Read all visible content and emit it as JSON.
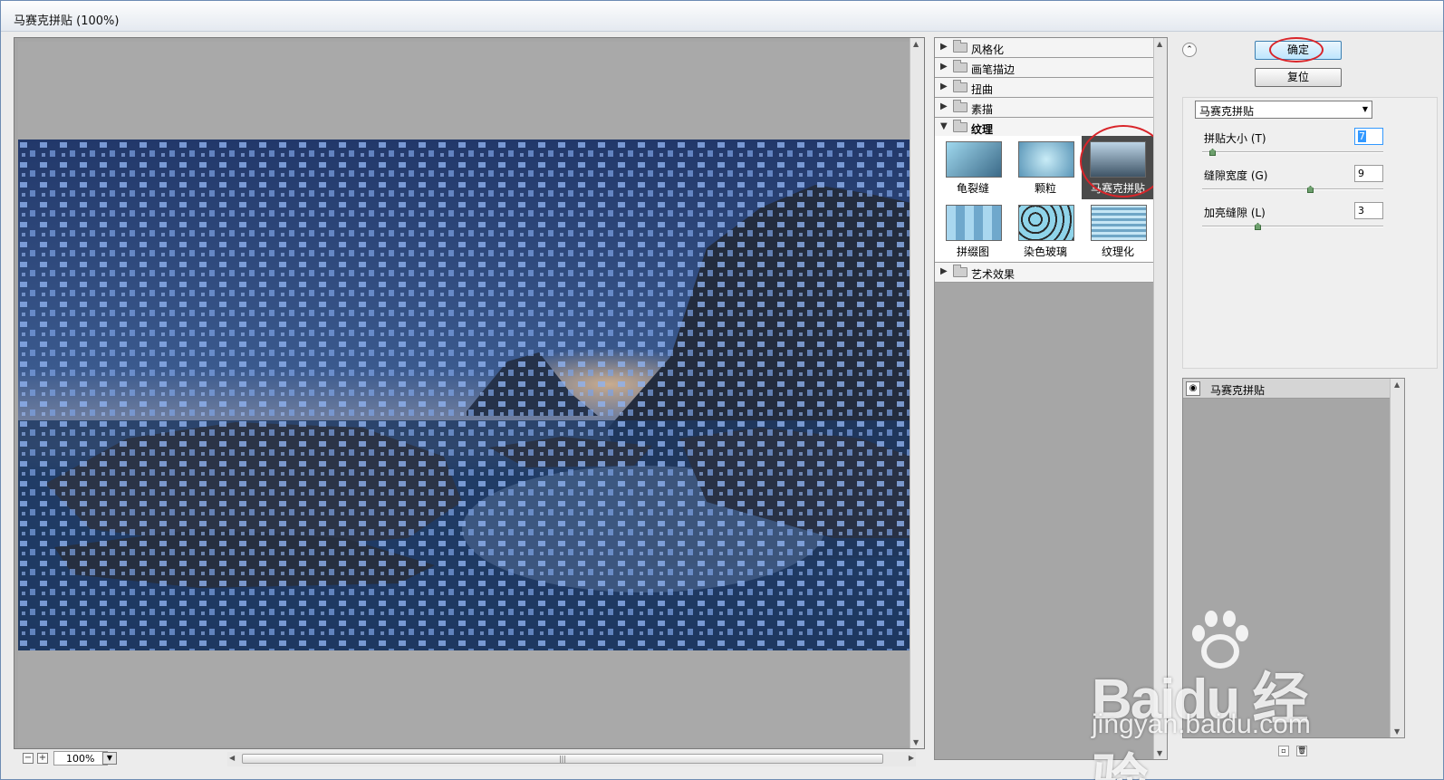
{
  "window": {
    "title": "马赛克拼贴 (100%)"
  },
  "preview": {
    "zoom": "100%"
  },
  "gallery": {
    "categories_top": [
      "风格化",
      "画笔描边",
      "扭曲",
      "素描"
    ],
    "open_category": "纹理",
    "thumbnails": [
      {
        "label": "龟裂缝"
      },
      {
        "label": "颗粒"
      },
      {
        "label": "马赛克拼贴"
      },
      {
        "label": "拼缀图"
      },
      {
        "label": "染色玻璃"
      },
      {
        "label": "纹理化"
      }
    ],
    "selected_thumbnail": "马赛克拼贴",
    "categories_bottom": [
      "艺术效果"
    ]
  },
  "buttons": {
    "ok": "确定",
    "reset": "复位"
  },
  "options": {
    "filter_select": "马赛克拼贴",
    "params": [
      {
        "label": "拼贴大小 (T)",
        "value": "7",
        "slider_fraction": 0.04
      },
      {
        "label": "缝隙宽度 (G)",
        "value": "9",
        "slider_fraction": 0.6
      },
      {
        "label": "加亮缝隙 (L)",
        "value": "3",
        "slider_fraction": 0.3
      }
    ]
  },
  "layers": {
    "items": [
      {
        "name": "马赛克拼贴"
      }
    ]
  },
  "watermark": {
    "brand": "Baidu 经验",
    "url": "jingyan.baidu.com"
  },
  "colors": {
    "highlight_circle": "#d9252a",
    "selected_thumb_bg": "#4a4a4a"
  }
}
